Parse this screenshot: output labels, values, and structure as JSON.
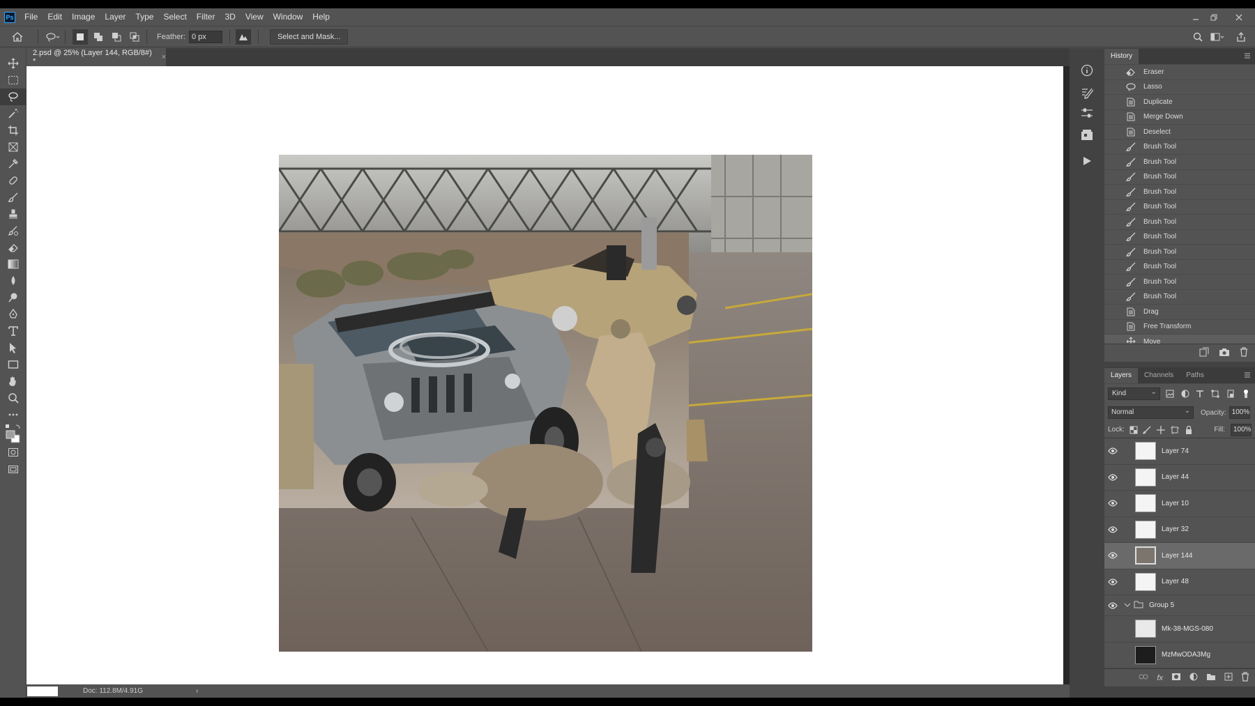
{
  "app": {
    "logo": "Ps"
  },
  "menu": [
    "File",
    "Edit",
    "Image",
    "Layer",
    "Type",
    "Select",
    "Filter",
    "3D",
    "View",
    "Window",
    "Help"
  ],
  "options": {
    "feather_label": "Feather:",
    "feather_value": "0 px",
    "select_mask_label": "Select and Mask..."
  },
  "document": {
    "tab_title": "2.psd @ 25% (Layer 144, RGB/8#) *",
    "close_glyph": "×"
  },
  "status": {
    "doc_size": "Doc: 112.8M/4.91G",
    "arrow": "›"
  },
  "history": {
    "tab": "History",
    "items": [
      {
        "label": "Eraser",
        "icon": "eraser-icon"
      },
      {
        "label": "Lasso",
        "icon": "lasso-icon"
      },
      {
        "label": "Duplicate",
        "icon": "doc-icon"
      },
      {
        "label": "Merge Down",
        "icon": "doc-icon"
      },
      {
        "label": "Deselect",
        "icon": "doc-icon"
      },
      {
        "label": "Brush Tool",
        "icon": "brush-icon"
      },
      {
        "label": "Brush Tool",
        "icon": "brush-icon"
      },
      {
        "label": "Brush Tool",
        "icon": "brush-icon"
      },
      {
        "label": "Brush Tool",
        "icon": "brush-icon"
      },
      {
        "label": "Brush Tool",
        "icon": "brush-icon"
      },
      {
        "label": "Brush Tool",
        "icon": "brush-icon"
      },
      {
        "label": "Brush Tool",
        "icon": "brush-icon"
      },
      {
        "label": "Brush Tool",
        "icon": "brush-icon"
      },
      {
        "label": "Brush Tool",
        "icon": "brush-icon"
      },
      {
        "label": "Brush Tool",
        "icon": "brush-icon"
      },
      {
        "label": "Brush Tool",
        "icon": "brush-icon"
      },
      {
        "label": "Drag",
        "icon": "doc-icon"
      },
      {
        "label": "Free Transform",
        "icon": "doc-icon"
      },
      {
        "label": "Move",
        "icon": "move-icon"
      }
    ]
  },
  "layers": {
    "tabs": [
      "Layers",
      "Channels",
      "Paths"
    ],
    "filter_kind": "Kind",
    "blend_mode": "Normal",
    "opacity_label": "Opacity:",
    "opacity_value": "100%",
    "lock_label": "Lock:",
    "fill_label": "Fill:",
    "fill_value": "100%",
    "items": [
      {
        "name": "Layer 74",
        "visible": true
      },
      {
        "name": "Layer 44",
        "visible": true
      },
      {
        "name": "Layer 10",
        "visible": true
      },
      {
        "name": "Layer 32",
        "visible": true
      },
      {
        "name": "Layer 144",
        "visible": true
      },
      {
        "name": "Layer 48",
        "visible": true
      },
      {
        "name": "Group 5",
        "visible": true
      },
      {
        "name": "Mk-38-MGS-080",
        "visible": false
      },
      {
        "name": "MzMwODA3Mg",
        "visible": false
      }
    ]
  },
  "colors": {
    "ui_bg": "#535353",
    "panel_dark": "#424242",
    "selection": "#6a6a6a",
    "accent": "#31a8ff"
  }
}
